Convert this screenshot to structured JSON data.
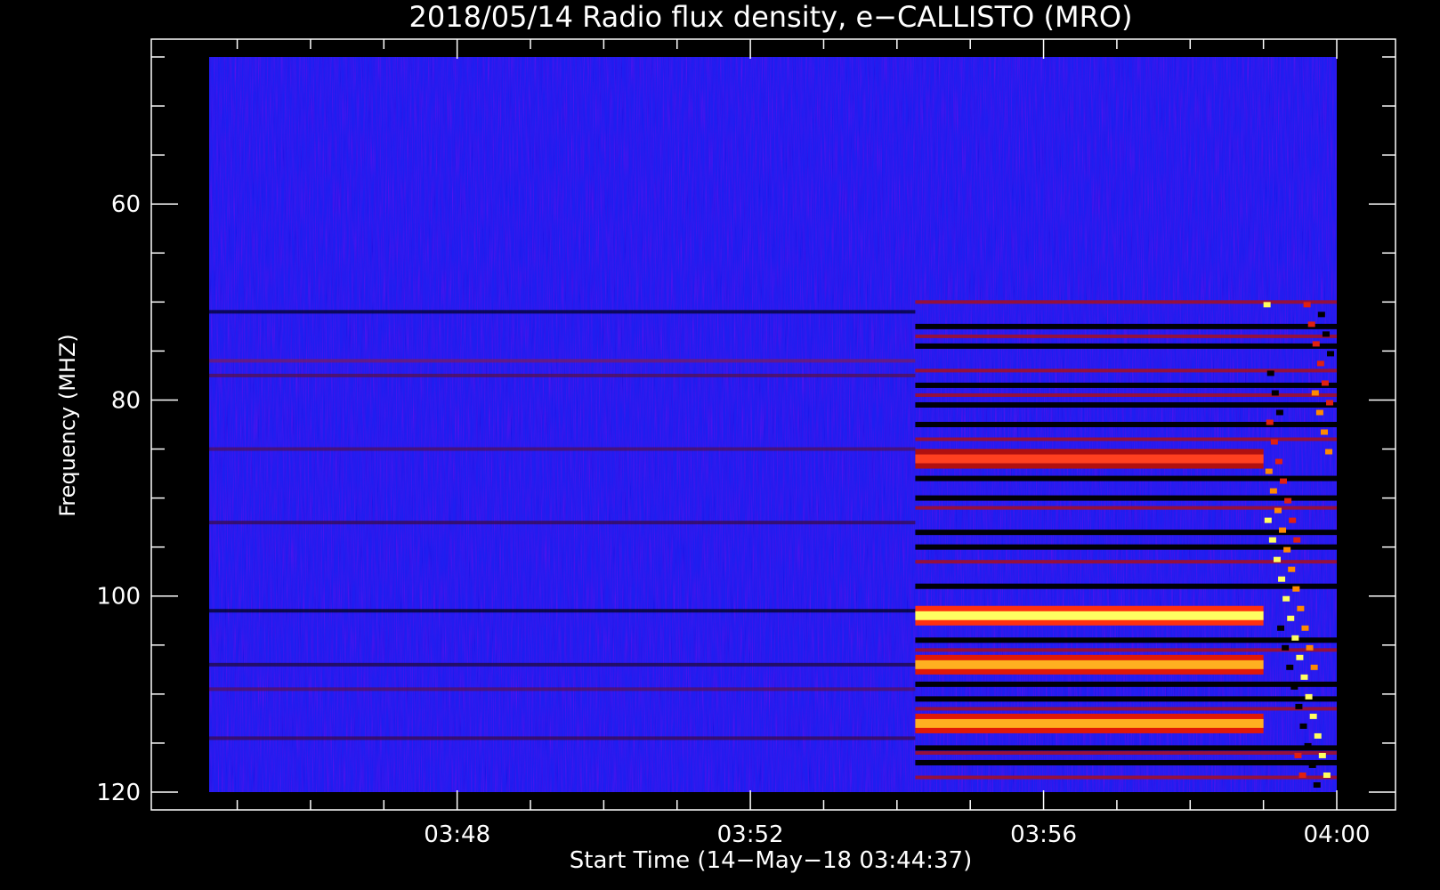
{
  "chart_data": {
    "type": "heatmap",
    "title": "2018/05/14  Radio flux density, e−CALLISTO (MRO)",
    "xlabel": "Start Time (14−May−18 03:44:37)",
    "ylabel": "Frequency (MHZ)",
    "x_start_time": "03:44:37",
    "x_end_time": "04:00:00",
    "x_ticks": [
      "03:48",
      "03:52",
      "03:56",
      "04:00"
    ],
    "y_ticks": [
      "60",
      "80",
      "100",
      "120"
    ],
    "y_range_mhz": [
      45,
      120
    ],
    "y_inverted": true,
    "colormap": [
      "#000000",
      "#1010ee",
      "#8a1030",
      "#e02010",
      "#ff8a00",
      "#ffff60"
    ],
    "bursts": [
      {
        "start": "03:54:15",
        "end": "04:00:00",
        "freq_mhz": [
          70,
          120
        ],
        "note": "broadband emission onset"
      },
      {
        "start": "03:54:15",
        "end": "03:59:00",
        "freq_mhz": [
          101,
          103
        ],
        "intensity": "max"
      },
      {
        "start": "03:54:15",
        "end": "03:59:00",
        "freq_mhz": [
          106,
          108
        ],
        "intensity": "high"
      },
      {
        "start": "03:54:15",
        "end": "03:59:00",
        "freq_mhz": [
          112,
          114
        ],
        "intensity": "high"
      },
      {
        "start": "03:54:15",
        "end": "03:59:00",
        "freq_mhz": [
          85,
          87
        ],
        "intensity": "medium"
      }
    ],
    "grid": false
  }
}
